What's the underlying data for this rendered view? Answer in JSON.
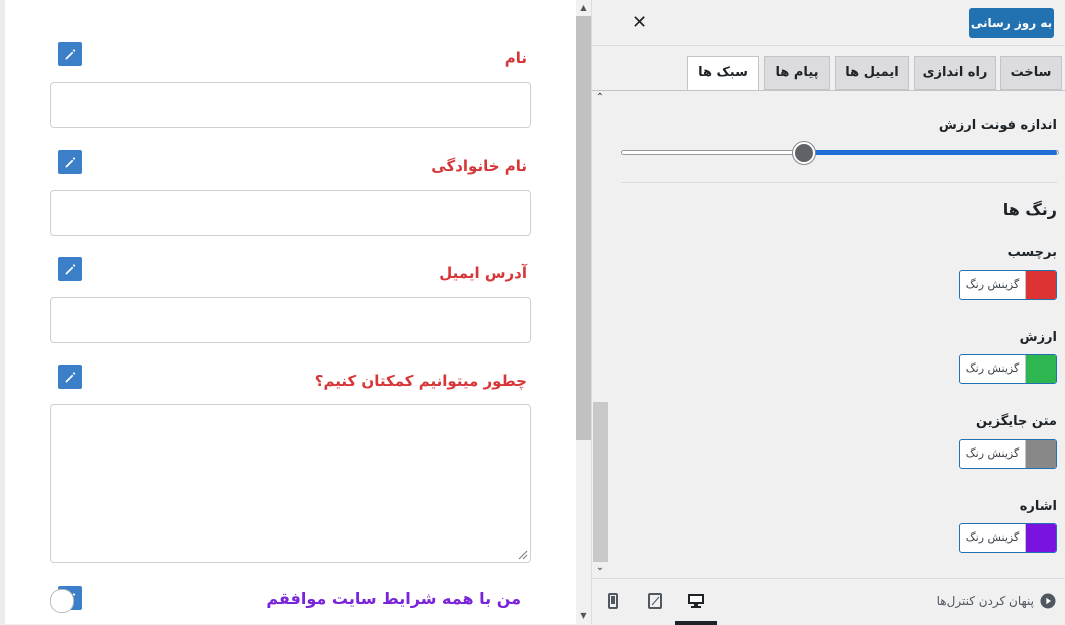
{
  "preview": {
    "fields": [
      {
        "label": "نام",
        "type": "text"
      },
      {
        "label": "نام خانوادگی",
        "type": "text"
      },
      {
        "label": "آدرس ایمیل",
        "type": "text"
      },
      {
        "label": "چطور میتوانیم کمکتان کنیم؟",
        "type": "textarea"
      }
    ],
    "checkbox_label": "من با همه شرایط سایت موافقم",
    "icons": {
      "edit": "pencil-icon",
      "grip": "resize-grip-icon"
    }
  },
  "header": {
    "update_label": "به روز رسانی",
    "close_icon": "close-icon"
  },
  "tabs": [
    "ساخت",
    "راه اندازی",
    "ایمیل ها",
    "پیام ها",
    "سبک ها"
  ],
  "active_tab": "سبک ها",
  "styles": {
    "font_size_label": "اندازه فونت ارزش",
    "font_size_slider_fraction": 0.58,
    "colors_title": "رنگ ها",
    "color_settings": [
      {
        "label": "برچسب",
        "button": "گزینش رنگ",
        "color": "#dd3333"
      },
      {
        "label": "ارزش",
        "button": "گزینش رنگ",
        "color": "#2eb650"
      },
      {
        "label": "متن جایگزین",
        "button": "گزینش رنگ",
        "color": "#888888"
      },
      {
        "label": "اشاره",
        "button": "گزینش رنگ",
        "color": "#7b13e0"
      }
    ]
  },
  "footer": {
    "hide_controls_label": "پنهان کردن کنترل‌ها",
    "devices": [
      "desktop-icon",
      "tablet-icon",
      "mobile-icon"
    ],
    "active_device": "desktop-icon"
  },
  "colors": {
    "accent": "#2271b1",
    "label_red": "#d63638",
    "checkbox_purple": "#7a23d9",
    "slider_blue": "#1e6ed6"
  }
}
